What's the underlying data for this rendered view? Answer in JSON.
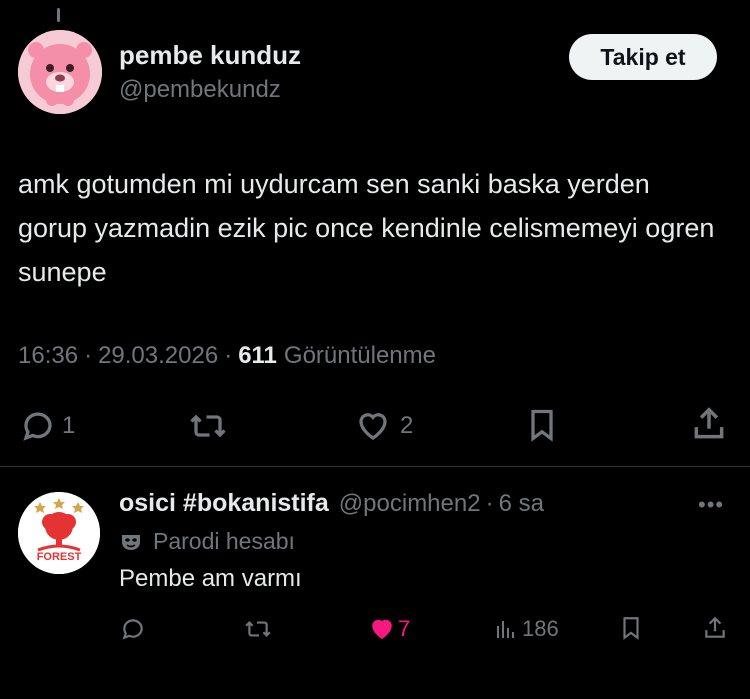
{
  "tweet": {
    "author_name": "pembe kunduz",
    "author_handle": "@pembekundz",
    "follow_label": "Takip et",
    "text": "amk gotumden mi uydurcam sen sanki baska yerden gorup yazmadin ezik pic once kendinle celismemeyi ogren sunepe",
    "time": "16:36",
    "date": "29.03.2026",
    "separator": "·",
    "views_count": "611",
    "views_label": "Görüntülenme",
    "reply_count": "1",
    "like_count": "2",
    "icons": [
      "reply-icon",
      "retweet-icon",
      "like-icon",
      "bookmark-icon",
      "share-icon"
    ]
  },
  "reply": {
    "author_name": "osici #bokanistifa",
    "author_handle": "@pocimhen2",
    "separator": "·",
    "time_ago": "6 sa",
    "more_label": "•••",
    "badge_label": "Parodi hesabı",
    "text": "Pembe am varmı",
    "like_count": "7",
    "views_count": "186",
    "avatar_text": "FOREST"
  },
  "colors": {
    "background": "#000000",
    "text": "#e7e9ea",
    "muted": "#71767b",
    "liked": "#f91880",
    "divider": "#2f3336",
    "forest_red": "#e53233"
  }
}
